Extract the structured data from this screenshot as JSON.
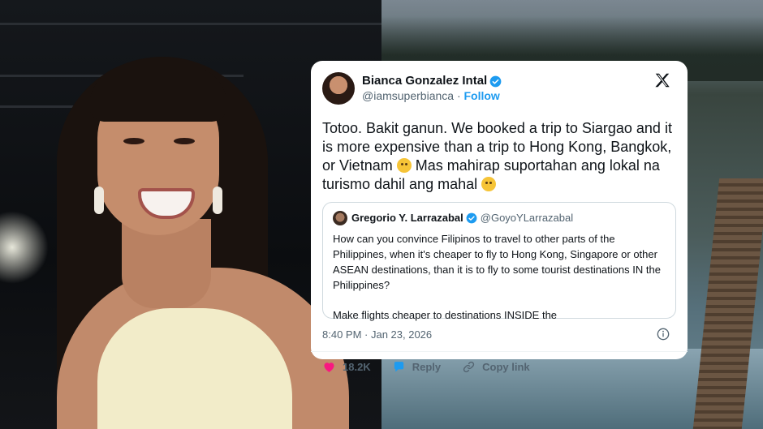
{
  "tweet": {
    "author_name": "Bianca Gonzalez Intal",
    "author_handle": "@iamsuperbianca",
    "separator": "·",
    "follow_label": "Follow",
    "text_part1": "Totoo. Bakit ganun. We booked a trip to Siargao and it is more expensive than a trip to Hong Kong, Bangkok, or Vietnam ",
    "text_part2": " Mas mahirap suportahan ang lokal na turismo dahil ang mahal ",
    "timestamp": "8:40 PM · Jan 23, 2026",
    "likes": "18.2K",
    "reply_label": "Reply",
    "copy_link_label": "Copy link"
  },
  "quoted": {
    "author_name": "Gregorio Y. Larrazabal",
    "author_handle": "@GoyoYLarrazabal",
    "paragraph1": "How can you convince Filipinos to travel to other parts of the Philippines, when it's cheaper to fly to Hong Kong, Singapore or other ASEAN destinations, than it is to fly to some tourist destinations IN the Philippines?",
    "paragraph2": "Make flights cheaper to destinations INSIDE the"
  },
  "icons": {
    "verified": "verified-badge-icon",
    "x_logo": "x-logo-icon",
    "info": "info-icon",
    "like": "heart-icon",
    "reply": "speech-bubble-icon",
    "copy": "link-icon",
    "emoji1": "sad-face-emoji",
    "emoji2": "confounded-face-emoji"
  },
  "colors": {
    "accent": "#1d9bf0",
    "like": "#f91880",
    "muted": "#536471"
  }
}
